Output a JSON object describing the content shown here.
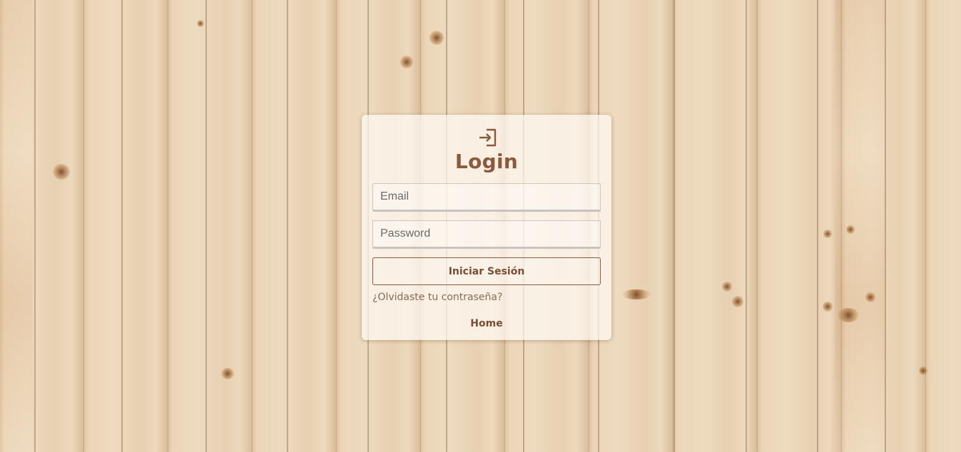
{
  "login": {
    "icon": "login-enter-icon",
    "title": "Login",
    "email_placeholder": "Email",
    "password_placeholder": "Password",
    "submit_label": "Iniciar Sesión",
    "forgot_label": "¿Olvidaste tu contraseña?",
    "home_label": "Home"
  },
  "colors": {
    "accent": "#8a5a3c",
    "background": "#ecd6b8"
  }
}
